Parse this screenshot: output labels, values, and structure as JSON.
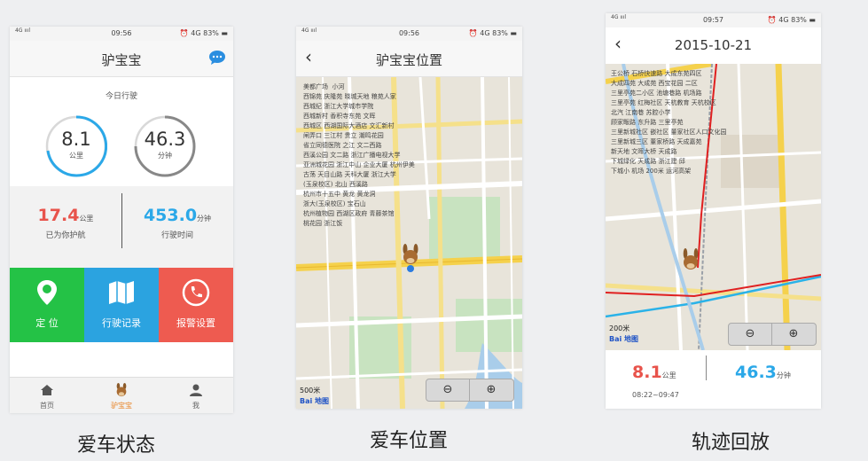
{
  "screen1": {
    "status": {
      "signal": "4G",
      "time": "09:56",
      "battery": "83%"
    },
    "title": "驴宝宝",
    "chat_icon": "chat-bubble-icon",
    "today_label": "今日行驶",
    "distance": {
      "value": "8.1",
      "unit": "公里"
    },
    "duration": {
      "value": "46.3",
      "unit": "分钟"
    },
    "total_distance": {
      "value": "17.4",
      "unit": "公里",
      "label": "已为你护航"
    },
    "total_time": {
      "value": "453.0",
      "unit": "分钟",
      "label": "行驶时间"
    },
    "tiles": [
      {
        "label": "定  位",
        "icon": "location-pin-icon",
        "color": "#24c246"
      },
      {
        "label": "行驶记录",
        "icon": "map-icon",
        "color": "#2ba3e0"
      },
      {
        "label": "报警设置",
        "icon": "phone-icon",
        "color": "#ee5b50"
      }
    ],
    "tabs": [
      {
        "label": "首页",
        "icon": "home-icon"
      },
      {
        "label": "驴宝宝",
        "icon": "donkey-icon"
      },
      {
        "label": "我",
        "icon": "user-icon"
      }
    ],
    "caption": "爱车状态"
  },
  "screen2": {
    "status": {
      "signal": "4G",
      "time": "09:56",
      "battery": "83%"
    },
    "title": "驴宝宝位置",
    "map_labels": [
      "美都广场",
      "小河",
      "西锦苑",
      "庆隆苑",
      "西城纪",
      "晓城天地",
      "浙江大学城市学院",
      "粮苑人家",
      "西城新村",
      "香积寺东苑",
      "文晖",
      "西城区",
      "西湖国际大酒店",
      "文汇新村",
      "闸弄口",
      "三江村",
      "贵立",
      "潮鸣花园",
      "省立同德医院",
      "之江",
      "文二西路",
      "西溪公园",
      "文二路",
      "浙江广播电视大学",
      "亚洲城花园",
      "浙江中山",
      "企业大厦",
      "杭州伊美",
      "古荡",
      "天目山路",
      "天科大厦",
      "浙江大学",
      "(玉泉校区)",
      "北山",
      "西溪路",
      "杭州市十五中",
      "黄龙",
      "黄龙洞",
      "浙大(玉泉校区)",
      "宝石山",
      "杭州植物园",
      "西湖区政府",
      "青藤茶馆",
      "桃花园",
      "浙江饭"
    ],
    "scale": "500米",
    "baidu": "Bai 地图",
    "caption": "爱车位置"
  },
  "screen3": {
    "status": {
      "signal": "4G",
      "time": "09:57",
      "battery": "83%"
    },
    "title": "2015-10-21",
    "map_labels": [
      "王公桥",
      "石桥快速路",
      "大成东苑四区",
      "大成四苑",
      "大成苑",
      "西宝花园",
      "二区",
      "三里亭苑二小区",
      "池塘巷路",
      "机场路",
      "三里亭苑",
      "红梅社区",
      "天杭教育",
      "天杭校区",
      "北汽",
      "江南巷",
      "苏腔小学",
      "顾家畈路",
      "东升路",
      "三里亭苑",
      "三里新城社区",
      "嵌社区",
      "董家社区人口文化园",
      "三里新城三区",
      "董家桥路",
      "天成嘉苑",
      "新天地",
      "文晖大桥",
      "天成路",
      "下城绿化",
      "天成路",
      "浙江建",
      "邱",
      "下城小",
      "机场",
      "200米",
      "运河高架"
    ],
    "scale": "200米",
    "baidu": "Bai 地图",
    "trip_distance": {
      "value": "8.1",
      "unit": "公里"
    },
    "trip_duration": {
      "value": "46.3",
      "unit": "分钟"
    },
    "trip_time": "08:22~09:47",
    "caption": "轨迹回放"
  }
}
